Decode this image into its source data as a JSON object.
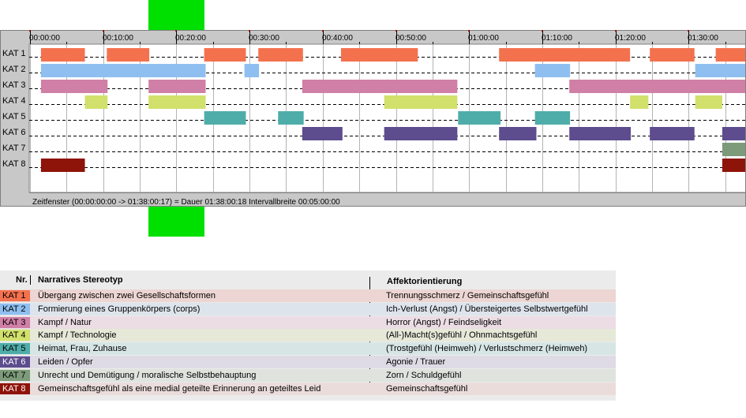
{
  "chart_data": {
    "type": "timeline",
    "time_axis": {
      "start": "00:00:00",
      "end": "01:38:00",
      "tick_labels": [
        "00:00:00",
        "00:10:00",
        "00:20:00",
        "00:30:00",
        "00:40:00",
        "00:50:00",
        "01:00:00",
        "01:10:00",
        "01:20:00",
        "01:30:00"
      ]
    },
    "rows": [
      "KAT 1",
      "KAT 2",
      "KAT 3",
      "KAT 4",
      "KAT 5",
      "KAT 6",
      "KAT 7",
      "KAT 8"
    ],
    "colors": [
      "#f4714e",
      "#8fbff0",
      "#d07fa6",
      "#d2e06c",
      "#4fada9",
      "#5d4c8e",
      "#7d9b7a",
      "#8e1309"
    ],
    "segments": [
      {
        "row": 0,
        "start": 1.5,
        "end": 7.5
      },
      {
        "row": 0,
        "start": 10.5,
        "end": 16.3
      },
      {
        "row": 0,
        "start": 23.8,
        "end": 29.5
      },
      {
        "row": 0,
        "start": 31.2,
        "end": 37.3
      },
      {
        "row": 0,
        "start": 42.5,
        "end": 53.0
      },
      {
        "row": 0,
        "start": 64.1,
        "end": 82.0
      },
      {
        "row": 0,
        "start": 84.7,
        "end": 90.8
      },
      {
        "row": 0,
        "start": 93.7,
        "end": 98.0
      },
      {
        "row": 1,
        "start": 1.5,
        "end": 24.0
      },
      {
        "row": 1,
        "start": 29.3,
        "end": 31.3
      },
      {
        "row": 1,
        "start": 69.0,
        "end": 73.8
      },
      {
        "row": 1,
        "start": 90.9,
        "end": 98.0
      },
      {
        "row": 2,
        "start": 1.5,
        "end": 10.6
      },
      {
        "row": 2,
        "start": 16.2,
        "end": 24.0
      },
      {
        "row": 2,
        "start": 37.2,
        "end": 58.4
      },
      {
        "row": 2,
        "start": 73.7,
        "end": 98.0
      },
      {
        "row": 3,
        "start": 7.5,
        "end": 10.6
      },
      {
        "row": 3,
        "start": 16.2,
        "end": 24.0
      },
      {
        "row": 3,
        "start": 48.4,
        "end": 58.4
      },
      {
        "row": 3,
        "start": 82.0,
        "end": 84.5
      },
      {
        "row": 3,
        "start": 90.9,
        "end": 94.6
      },
      {
        "row": 4,
        "start": 23.8,
        "end": 29.5
      },
      {
        "row": 4,
        "start": 33.9,
        "end": 37.4
      },
      {
        "row": 4,
        "start": 58.5,
        "end": 64.3
      },
      {
        "row": 4,
        "start": 69.0,
        "end": 73.8
      },
      {
        "row": 5,
        "start": 37.2,
        "end": 42.7
      },
      {
        "row": 5,
        "start": 48.4,
        "end": 58.4
      },
      {
        "row": 5,
        "start": 64.1,
        "end": 69.2
      },
      {
        "row": 5,
        "start": 73.7,
        "end": 82.1
      },
      {
        "row": 5,
        "start": 84.7,
        "end": 90.8
      },
      {
        "row": 5,
        "start": 94.6,
        "end": 98.0
      },
      {
        "row": 6,
        "start": 94.6,
        "end": 98.0
      },
      {
        "row": 7,
        "start": 1.5,
        "end": 7.5
      },
      {
        "row": 7,
        "start": 94.6,
        "end": 98.0
      }
    ],
    "status": "Zeitfenster (00:00:00:00 -> 01:38:00:17) = Dauer 01:38:00:18    Intervallbreite 00:05:00:00"
  },
  "legend": {
    "header_nr": "Nr.",
    "header_stereotype": "Narratives Stereotyp",
    "header_affect": "Affektorientierung",
    "rows": [
      {
        "label": "KAT 1",
        "stereotype": "Übergang zwischen zwei Gesellschaftsformen",
        "affect": "Trennungsschmerz / Gemeinschaftsgefühl",
        "color": "#f4714e",
        "band": "#ecd5d2"
      },
      {
        "label": "KAT 2",
        "stereotype": "Formierung eines Gruppenkörpers (corps)",
        "affect": "Ich-Verlust (Angst) / Übersteigertes Selbstwertgefühl",
        "color": "#8fbff0",
        "band": "#dde4ec"
      },
      {
        "label": "KAT 3",
        "stereotype": "Kampf / Natur",
        "affect": "Horror (Angst) / Feindseligkeit",
        "color": "#d07fa6",
        "band": "#ebdde3"
      },
      {
        "label": "KAT 4",
        "stereotype": "Kampf / Technologie",
        "affect": "(All-)Macht(s)gefühl / Ohnmachtsgefühl",
        "color": "#d2e06c",
        "band": "#e6e8d8"
      },
      {
        "label": "KAT 5",
        "stereotype": "Heimat, Frau, Zuhause",
        "affect": "(Trostgefühl (Heimweh) / Verlustschmerz (Heimweh)",
        "color": "#4fada9",
        "band": "#d7e6e5"
      },
      {
        "label": "KAT 6",
        "stereotype": "Leiden / Opfer",
        "affect": "Agonie / Trauer",
        "color": "#5d4c8e",
        "band": "#dedbe5"
      },
      {
        "label": "KAT 7",
        "stereotype": "Unrecht und Demütigung / moralische Selbstbehauptung",
        "affect": "Zorn / Schuldgefühl",
        "color": "#7d9b7a",
        "band": "#dee3dd"
      },
      {
        "label": "KAT 8",
        "stereotype": "Gemeinschaftsgefühl als eine medial geteilte Erinnerung an geteiltes Leid",
        "affect": "Gemeinschaftsgefühl",
        "color": "#8e1309",
        "band": "#ebdcdc"
      }
    ]
  }
}
